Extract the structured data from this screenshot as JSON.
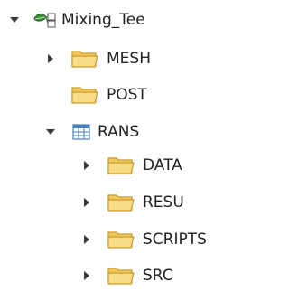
{
  "tree": {
    "root": {
      "label": "Mixing_Tee",
      "expanded": true,
      "icon": "study-leaf-icon",
      "children": [
        {
          "label": "MESH",
          "icon": "folder-icon",
          "expanded": false,
          "has_children": true
        },
        {
          "label": "POST",
          "icon": "folder-icon",
          "expanded": false,
          "has_children": false
        },
        {
          "label": "RANS",
          "icon": "case-table-icon",
          "expanded": true,
          "has_children": true,
          "children": [
            {
              "label": "DATA",
              "icon": "folder-icon",
              "expanded": false,
              "has_children": true
            },
            {
              "label": "RESU",
              "icon": "folder-icon",
              "expanded": false,
              "has_children": true
            },
            {
              "label": "SCRIPTS",
              "icon": "folder-icon",
              "expanded": false,
              "has_children": true
            },
            {
              "label": "SRC",
              "icon": "folder-icon",
              "expanded": false,
              "has_children": true
            }
          ]
        }
      ]
    }
  },
  "colors": {
    "folder_fill": "#f5d77a",
    "folder_stroke": "#c99a2e",
    "arrow": "#3a3a3a",
    "case_icon_blue": "#4a7fc1",
    "leaf_green": "#3e8e3a"
  }
}
